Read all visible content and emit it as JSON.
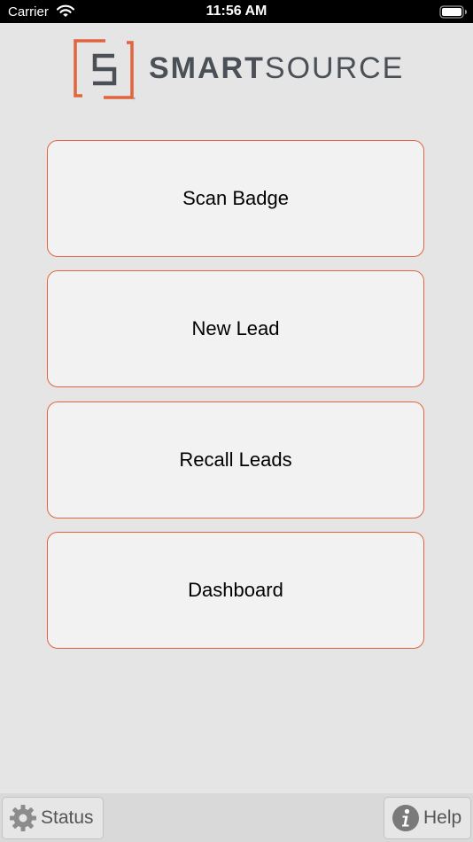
{
  "status_bar": {
    "carrier": "Carrier",
    "time": "11:56 AM"
  },
  "brand": {
    "name_bold": "SMART",
    "name_light": "SOURCE",
    "trademark": "™",
    "accent_color": "#e0643d",
    "text_color": "#4a5056"
  },
  "menu": {
    "items": [
      {
        "label": "Scan Badge"
      },
      {
        "label": "New Lead"
      },
      {
        "label": "Recall Leads"
      },
      {
        "label": "Dashboard"
      }
    ]
  },
  "footer": {
    "status": {
      "label": "Status",
      "icon": "gear-icon"
    },
    "help": {
      "label": "Help",
      "icon": "info-icon"
    }
  }
}
